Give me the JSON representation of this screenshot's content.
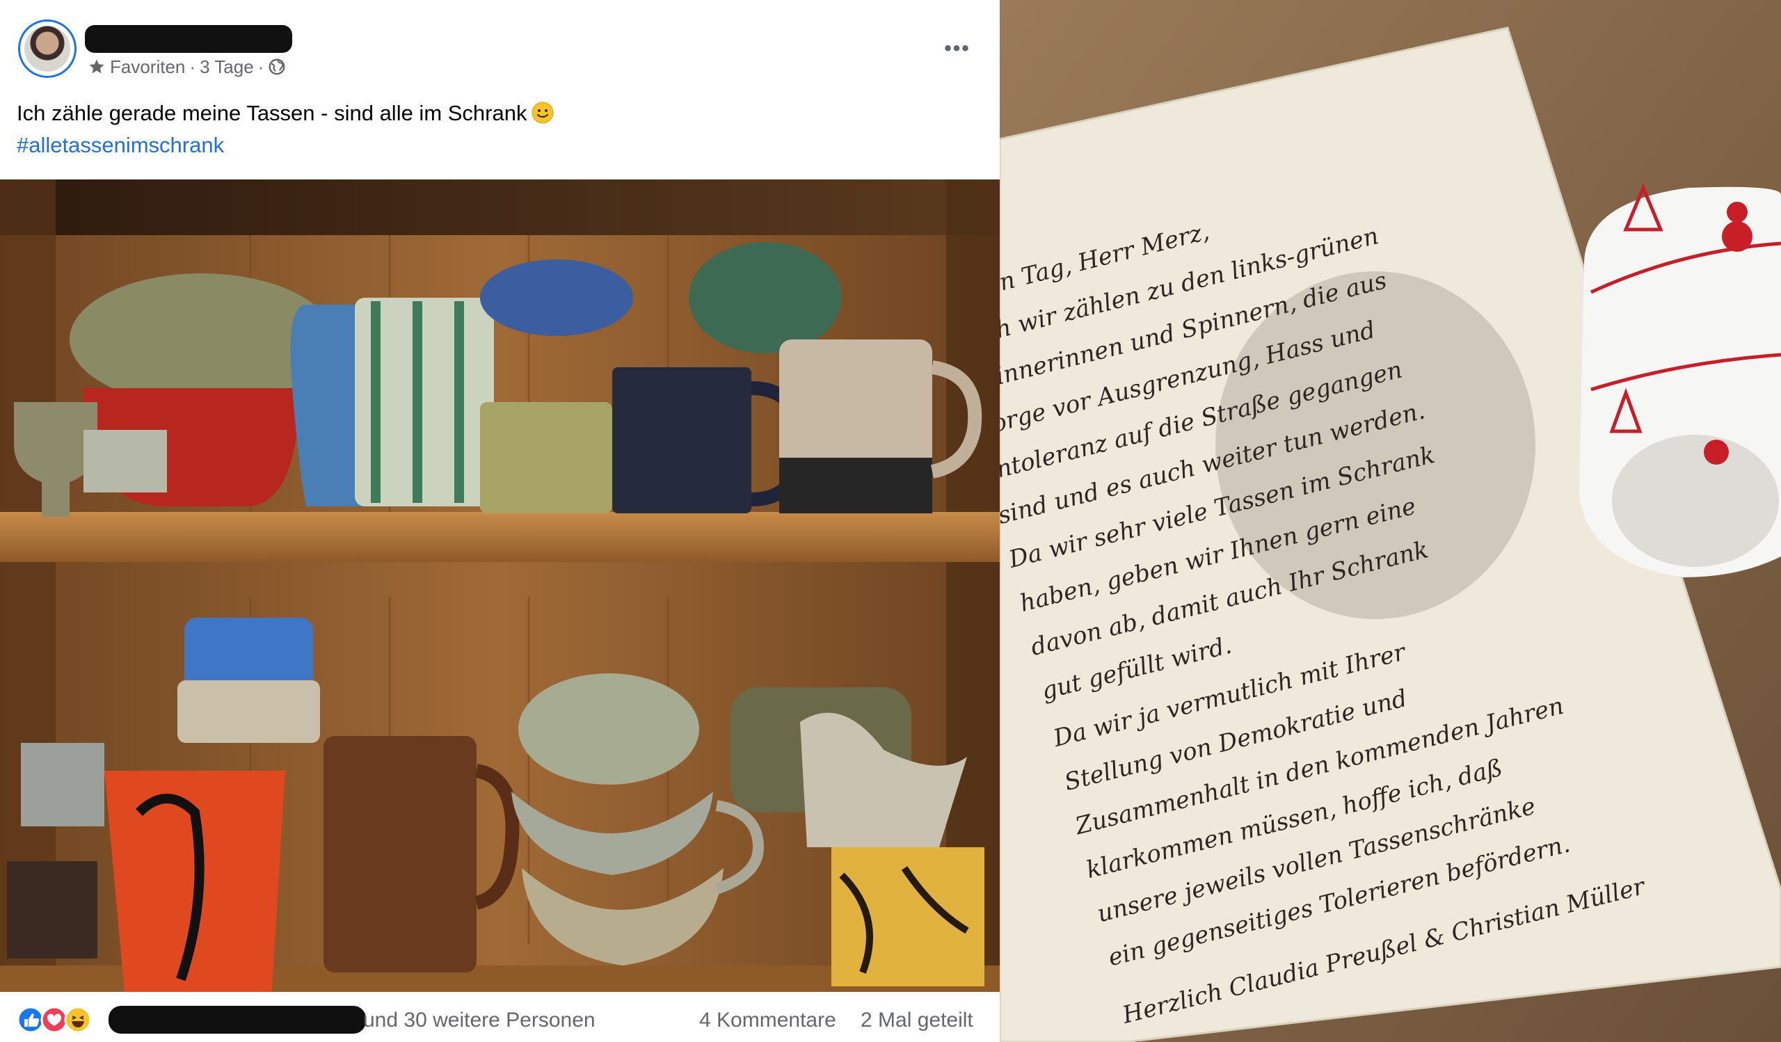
{
  "post": {
    "author": "",
    "audience": "Favoriten",
    "separator": "·",
    "time": "3 Tage",
    "visibility_icon": "globe-icon",
    "text": "Ich zähle gerade meine Tassen - sind alle im Schrank",
    "emoji": "slightly-smiling-face",
    "hashtag": "#alletassenimschrank",
    "more_label": "•••"
  },
  "footer": {
    "reaction_icons": [
      "like-icon",
      "love-icon",
      "haha-icon"
    ],
    "reactors_suffix": "und 30 weitere Personen",
    "comments": "4 Kommentare",
    "shares": "2 Mal geteilt"
  },
  "letter": {
    "lines": [
      "Guten Tag, Herr Merz,",
      "auch wir zählen zu den links-grünen",
      "Spinnerinnen und Spinnern, die aus",
      "Sorge vor Ausgrenzung, Hass und",
      "Intoleranz auf die Straße gegangen",
      "sind und es auch weiter tun werden.",
      "Da wir sehr viele Tassen im Schrank",
      "haben, geben wir Ihnen gern eine",
      "davon ab, damit auch Ihr Schrank",
      "gut gefüllt wird.",
      "Da wir ja vermutlich mit Ihrer",
      "Stellung von Demokratie und",
      "Zusammenhalt in den kommenden Jahren",
      "klarkommen müssen, hoffe ich, daß",
      "unsere jeweils vollen Tassenschränke",
      "ein gegenseitiges Tolerieren befördern.",
      "Herzlich  Claudia Preußel & Christian Müller"
    ]
  },
  "colors": {
    "accent": "#1b74e4",
    "hashtag": "#216fdb",
    "meta_text": "#65676b",
    "post_text": "#050505"
  }
}
